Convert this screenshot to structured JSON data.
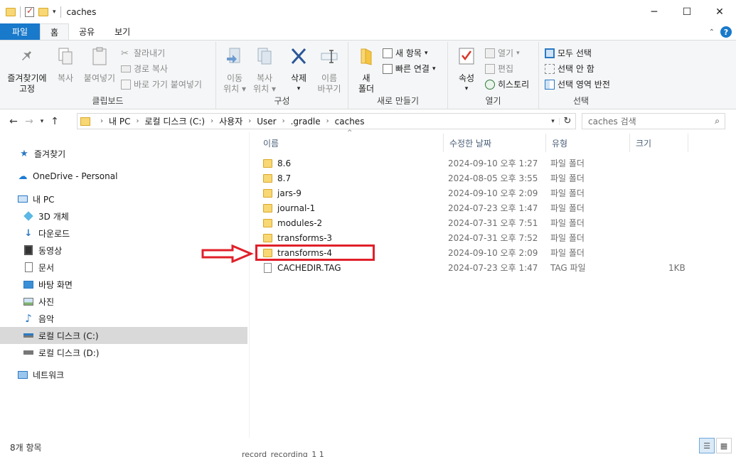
{
  "window": {
    "title": "caches",
    "controls": [
      "minimize",
      "maximize",
      "close"
    ]
  },
  "ribbon": {
    "tabs": [
      {
        "label": "파일"
      },
      {
        "label": "홈"
      },
      {
        "label": "공유"
      },
      {
        "label": "보기"
      }
    ],
    "clipboard": {
      "group_label": "클립보드",
      "pin_label_1": "즐겨찾기에",
      "pin_label_2": "고정",
      "copy_label": "복사",
      "paste_label": "붙여넣기",
      "cut_label": "잘라내기",
      "copy_path_label": "경로 복사",
      "paste_shortcut_label": "바로 가기 붙여넣기"
    },
    "organize": {
      "group_label": "구성",
      "move_to_1": "이동",
      "move_to_2": "위치",
      "copy_to_1": "복사",
      "copy_to_2": "위치",
      "delete_label": "삭제",
      "rename_1": "이름",
      "rename_2": "바꾸기"
    },
    "new": {
      "group_label": "새로 만들기",
      "new_folder_1": "새",
      "new_folder_2": "폴더",
      "new_item_label": "새 항목",
      "easy_access_label": "빠른 연결"
    },
    "open": {
      "group_label": "열기",
      "properties_label": "속성",
      "open_label": "열기",
      "edit_label": "편집",
      "history_label": "히스토리"
    },
    "select": {
      "group_label": "선택",
      "select_all_label": "모두 선택",
      "select_none_label": "선택 안 함",
      "invert_label": "선택 영역 반전"
    }
  },
  "address": {
    "crumbs": [
      "내 PC",
      "로컬 디스크 (C:)",
      "사용자",
      "User",
      ".gradle",
      "caches"
    ],
    "search_placeholder": "caches 검색"
  },
  "nav_pane": {
    "items": [
      {
        "label": "즐겨찾기",
        "icon": "star-icon"
      },
      {
        "label": "OneDrive - Personal",
        "icon": "cloud-icon"
      },
      {
        "label": "내 PC",
        "icon": "pc-icon"
      },
      {
        "label": "3D 개체",
        "icon": "cube-icon"
      },
      {
        "label": "다운로드",
        "icon": "download-icon"
      },
      {
        "label": "동영상",
        "icon": "video-icon"
      },
      {
        "label": "문서",
        "icon": "document-icon"
      },
      {
        "label": "바탕 화면",
        "icon": "desktop-icon"
      },
      {
        "label": "사진",
        "icon": "picture-icon"
      },
      {
        "label": "음악",
        "icon": "music-icon"
      },
      {
        "label": "로컬 디스크 (C:)",
        "icon": "drive-icon"
      },
      {
        "label": "로컬 디스크 (D:)",
        "icon": "drive-icon"
      },
      {
        "label": "네트워크",
        "icon": "network-icon"
      }
    ],
    "selected": "로컬 디스크 (C:)"
  },
  "file_list": {
    "columns": [
      "이름",
      "수정한 날짜",
      "유형",
      "크기"
    ],
    "rows": [
      {
        "name": "8.6",
        "date": "2024-09-10 오후 1:27",
        "type": "파일 폴더",
        "size": "",
        "kind": "folder"
      },
      {
        "name": "8.7",
        "date": "2024-08-05 오후 3:55",
        "type": "파일 폴더",
        "size": "",
        "kind": "folder"
      },
      {
        "name": "jars-9",
        "date": "2024-09-10 오후 2:09",
        "type": "파일 폴더",
        "size": "",
        "kind": "folder"
      },
      {
        "name": "journal-1",
        "date": "2024-07-23 오후 1:47",
        "type": "파일 폴더",
        "size": "",
        "kind": "folder"
      },
      {
        "name": "modules-2",
        "date": "2024-07-31 오후 7:51",
        "type": "파일 폴더",
        "size": "",
        "kind": "folder"
      },
      {
        "name": "transforms-3",
        "date": "2024-07-31 오후 7:52",
        "type": "파일 폴더",
        "size": "",
        "kind": "folder"
      },
      {
        "name": "transforms-4",
        "date": "2024-09-10 오후 2:09",
        "type": "파일 폴더",
        "size": "",
        "kind": "folder"
      },
      {
        "name": "CACHEDIR.TAG",
        "date": "2024-07-23 오후 1:47",
        "type": "TAG 파일",
        "size": "1KB",
        "kind": "file"
      }
    ],
    "highlighted": "transforms-4"
  },
  "status": {
    "item_count": "8개 항목"
  },
  "bleed_text": "record_recording_1 1",
  "colors": {
    "accent": "#1979ca",
    "highlight": "#e0202a",
    "folder": "#f8d775"
  }
}
